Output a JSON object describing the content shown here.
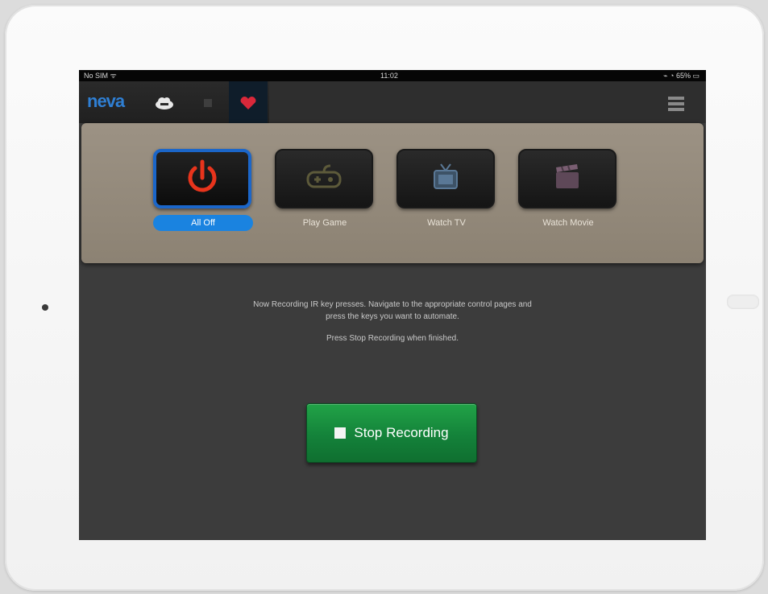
{
  "status_bar": {
    "carrier": "No SIM ᯤ",
    "time": "11:02",
    "battery": "⌁ ◔ 65% ▭"
  },
  "header": {
    "logo": "neva",
    "icons": [
      "cloud-icon",
      "chip-icon",
      "heart-icon",
      "menu-icon"
    ]
  },
  "activities": [
    {
      "label": "All Off",
      "icon": "power-icon",
      "selected": true
    },
    {
      "label": "Play Game",
      "icon": "gamepad-icon",
      "selected": false
    },
    {
      "label": "Watch TV",
      "icon": "tv-icon",
      "selected": false
    },
    {
      "label": "Watch Movie",
      "icon": "clapperboard-icon",
      "selected": false
    }
  ],
  "recording": {
    "instruction_line1": "Now Recording IR key presses. Navigate to the appropriate control pages and",
    "instruction_line2": "press the keys you want to automate.",
    "hint": "Press Stop Recording when finished.",
    "stop_label": "Stop Recording"
  },
  "colors": {
    "accent": "#1a83e0",
    "stop_button": "#14823a",
    "power_icon": "#e8341c",
    "heart_icon": "#d9283a"
  }
}
